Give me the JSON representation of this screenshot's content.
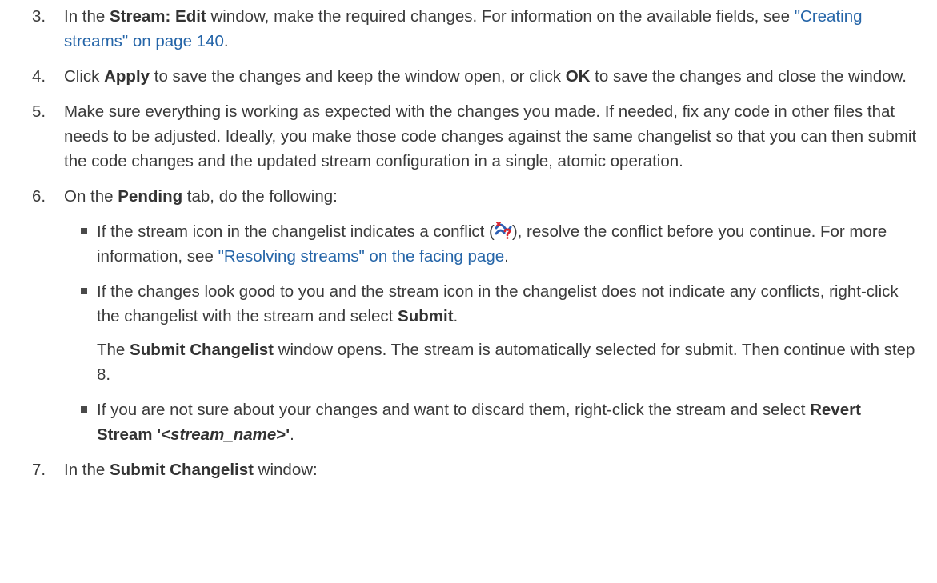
{
  "steps": {
    "s3": {
      "num": "3.",
      "a": "In the ",
      "b1": "Stream: Edit",
      "c": " window, make the required changes. For information on the available fields, see ",
      "link": "\"Creating streams\" on page 140",
      "d": "."
    },
    "s4": {
      "num": "4.",
      "a": "Click ",
      "b1": "Apply",
      "c": " to save the changes and keep the window open, or click ",
      "b2": "OK",
      "d": " to save the changes and close the window."
    },
    "s5": {
      "num": "5.",
      "text": "Make sure everything is working as expected with the changes you made. If needed, fix any code in other files that needs to be adjusted. Ideally, you make those code changes against the same changelist so that you can then submit the code changes and the updated stream configuration in a single, atomic operation."
    },
    "s6": {
      "num": "6.",
      "a": "On the ",
      "b1": "Pending",
      "c": " tab, do the following:",
      "bullets": {
        "b1": {
          "a": "If the stream icon in the changelist indicates a conflict (",
          "icon": "stream-conflict-icon",
          "c": "), resolve the conflict before you continue. For more information, see ",
          "link": "\"Resolving streams\" on the facing page",
          "d": "."
        },
        "b2": {
          "a": "If the changes look good to you and the stream icon in the changelist does not indicate any conflicts, right-click the changelist with the stream and select ",
          "b1": "Submit",
          "d": "."
        },
        "note": {
          "a": "The ",
          "b1": "Submit Changelist",
          "c": " window opens. The stream is automatically selected for submit. Then continue with step 8."
        },
        "b3": {
          "a": "If you are not sure about your changes and want to discard them, right-click the stream and select ",
          "b1": "Revert Stream '<",
          "bi": "stream_name",
          "b2": ">'",
          "d": "."
        }
      }
    },
    "s7": {
      "num": "7.",
      "a": "In the ",
      "b1": "Submit Changelist",
      "c": " window:"
    }
  },
  "colors": {
    "text": "#3b3b3b",
    "link": "#2565a8",
    "icon_red": "#d9232d",
    "icon_blue": "#2d5fb4"
  }
}
